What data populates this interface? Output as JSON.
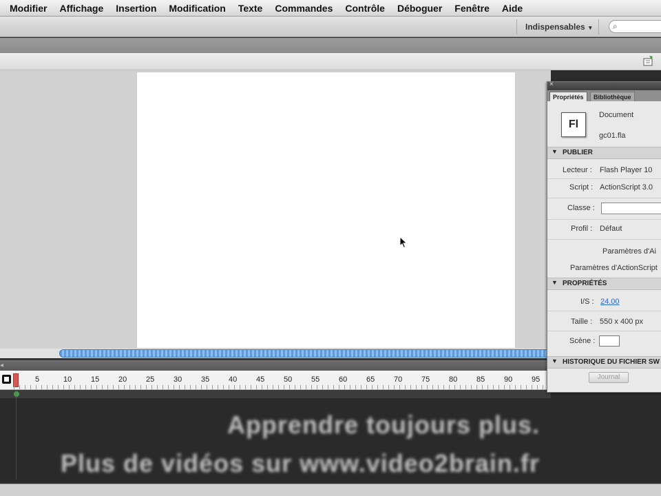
{
  "menu": [
    "Modifier",
    "Affichage",
    "Insertion",
    "Modification",
    "Texte",
    "Commandes",
    "Contrôle",
    "Déboguer",
    "Fenêtre",
    "Aide"
  ],
  "toolbar": {
    "workspace_label": "Indispensables",
    "workspace_caret": "▾",
    "search_icon": "⌕"
  },
  "timeline": {
    "frame_numbers": [
      "5",
      "10",
      "15",
      "20",
      "25",
      "30",
      "35",
      "40",
      "45",
      "50",
      "55",
      "60",
      "65",
      "70",
      "75",
      "80",
      "85",
      "90",
      "95"
    ]
  },
  "properties": {
    "tab_properties": "Propriétés",
    "tab_library": "Bibliothèque",
    "doc_icon_text": "Fl",
    "doc_type": "Document",
    "doc_name": "gc01.fla",
    "section_publish": "PUBLIER",
    "player_label": "Lecteur :",
    "player_value": "Flash Player 10",
    "script_label": "Script :",
    "script_value": "ActionScript 3.0",
    "class_label": "Classe :",
    "profile_label": "Profil :",
    "profile_value": "Défaut",
    "params_air": "Paramètres d'Ai",
    "params_as": "Paramètres d'ActionScript",
    "section_props": "PROPRIÉTÉS",
    "fps_label": "I/S :",
    "fps_value": "24.00",
    "size_label": "Taille :",
    "size_value": "550 x 400 px",
    "scene_label": "Scène :",
    "section_history": "HISTORIQUE DU FICHIER SW",
    "journal_button": "Journal"
  },
  "watermark": {
    "line1": "Apprendre toujours plus.",
    "line2": "Plus de vidéos sur www.video2brain.fr"
  },
  "colors": {
    "accent": "#2a67c4",
    "playhead": "#d63b3b",
    "scroll_thumb": "#5d9ce3"
  }
}
